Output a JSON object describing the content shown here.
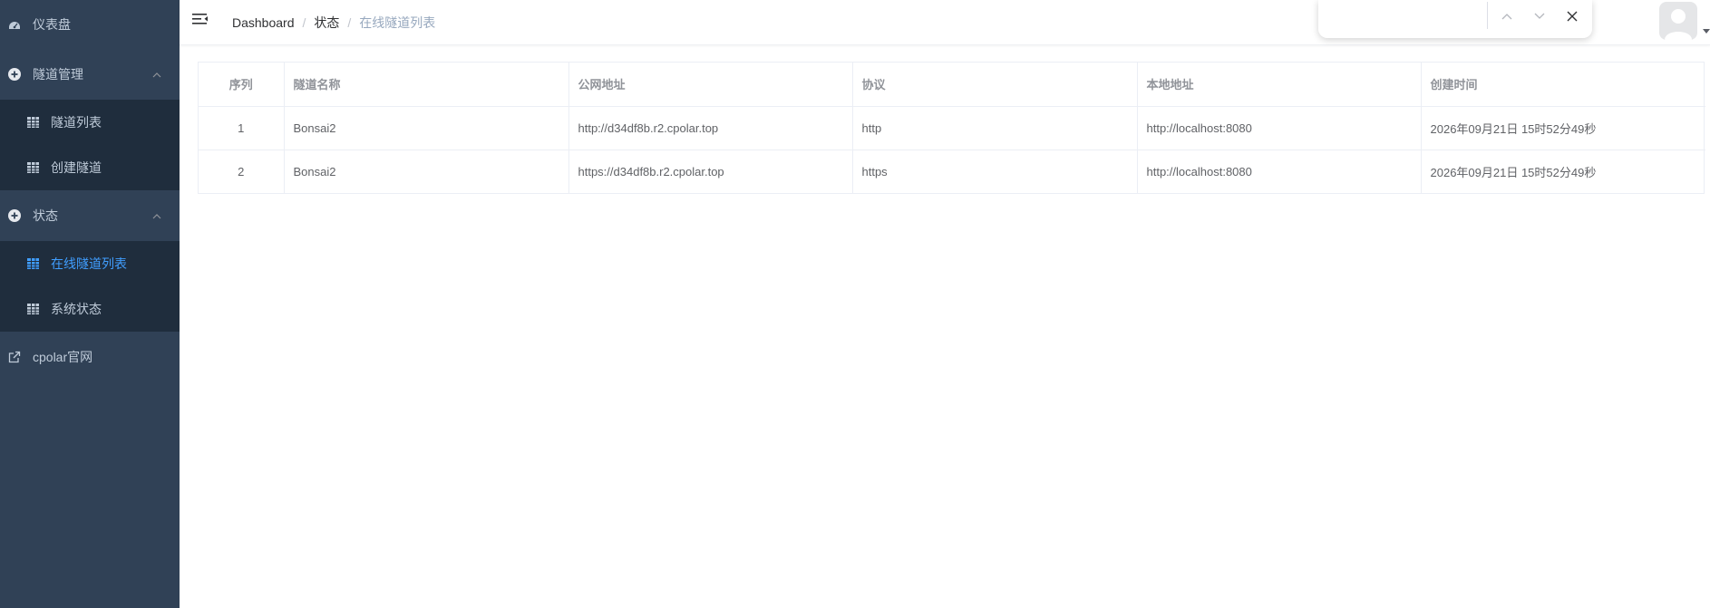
{
  "sidebar": {
    "dashboard": {
      "label": "仪表盘",
      "icon": "dashboard-icon"
    },
    "groups": [
      {
        "label": "隧道管理",
        "icon": "plus-circle-icon",
        "expanded": true,
        "items": [
          {
            "label": "隧道列表",
            "icon": "grid-icon",
            "active": false
          },
          {
            "label": "创建隧道",
            "icon": "grid-icon",
            "active": false
          }
        ]
      },
      {
        "label": "状态",
        "icon": "plus-circle-icon",
        "expanded": true,
        "items": [
          {
            "label": "在线隧道列表",
            "icon": "grid-icon",
            "active": true
          },
          {
            "label": "系统状态",
            "icon": "grid-icon",
            "active": false
          }
        ]
      }
    ],
    "external": {
      "label": "cpolar官网",
      "icon": "external-link-icon"
    }
  },
  "breadcrumb": [
    "Dashboard",
    "状态",
    "在线隧道列表"
  ],
  "colors": {
    "sidebar_bg": "#304156",
    "submenu_bg": "#1f2d3d",
    "accent": "#409eff"
  },
  "table": {
    "headers": [
      "序列",
      "隧道名称",
      "公网地址",
      "协议",
      "本地地址",
      "创建时间"
    ],
    "rows": [
      [
        "1",
        "Bonsai2",
        "http://d34df8b.r2.cpolar.top",
        "http",
        "http://localhost:8080",
        "2026年09月21日 15时52分49秒"
      ],
      [
        "2",
        "Bonsai2",
        "https://d34df8b.r2.cpolar.top",
        "https",
        "http://localhost:8080",
        "2026年09月21日 15时52分49秒"
      ]
    ]
  }
}
